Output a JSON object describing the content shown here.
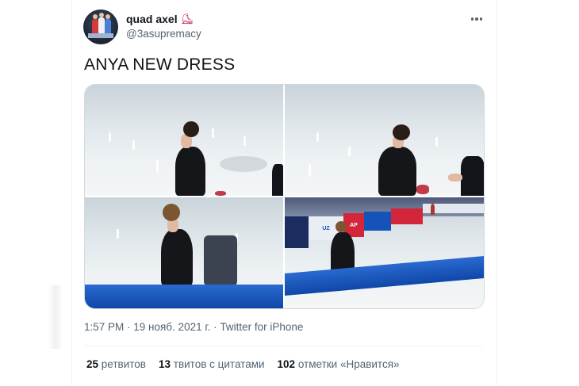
{
  "tweet": {
    "author_name": "quad axel",
    "author_emoji_icon": "ice-skater-icon",
    "handle": "@3asupremacy",
    "text": "ANYA NEW DRESS",
    "time": "1:57 PM",
    "sep1": " · ",
    "date": "19 нояб. 2021 г.",
    "sep2": " · ",
    "source": "Twitter for iPhone"
  },
  "stats": {
    "retweets_count": "25",
    "retweets_label": "ретвитов",
    "quotes_count": "13",
    "quotes_label": "твитов с цитатами",
    "likes_count": "102",
    "likes_label": "отметки «Нравится»"
  },
  "media": {
    "photos": [
      "photo-1",
      "photo-2",
      "photo-3",
      "photo-4"
    ]
  },
  "colors": {
    "text_primary": "#0f1419",
    "text_secondary": "#536471",
    "border": "#cfd9de",
    "barrier_blue": "#1553b8"
  }
}
